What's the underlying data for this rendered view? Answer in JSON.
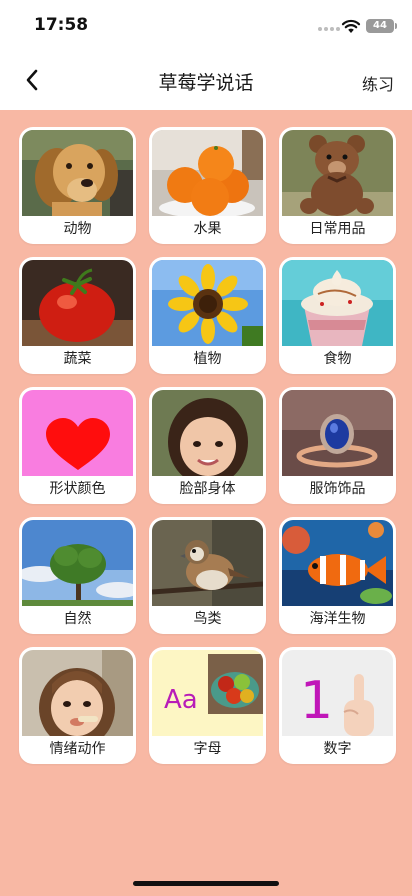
{
  "status_bar": {
    "time": "17:58",
    "battery": "44"
  },
  "nav": {
    "title": "草莓学说话",
    "right_action": "练习",
    "back_icon": "chevron-left-icon"
  },
  "colors": {
    "background": "#f8b8a4",
    "card": "#ffffff"
  },
  "categories": [
    {
      "label": "动物",
      "image": "dog-photo"
    },
    {
      "label": "水果",
      "image": "oranges-photo"
    },
    {
      "label": "日常用品",
      "image": "teddy-bear-photo"
    },
    {
      "label": "蔬菜",
      "image": "tomato-photo"
    },
    {
      "label": "植物",
      "image": "sunflower-photo"
    },
    {
      "label": "食物",
      "image": "ice-cream-photo"
    },
    {
      "label": "形状颜色",
      "image": "heart-shape"
    },
    {
      "label": "脸部身体",
      "image": "girl-face-photo"
    },
    {
      "label": "服饰饰品",
      "image": "ring-photo"
    },
    {
      "label": "自然",
      "image": "tree-photo"
    },
    {
      "label": "鸟类",
      "image": "sparrow-photo"
    },
    {
      "label": "海洋生物",
      "image": "clownfish-photo"
    },
    {
      "label": "情绪动作",
      "image": "child-eating-photo"
    },
    {
      "label": "字母",
      "image": "letters-apples",
      "image_text": "Aa"
    },
    {
      "label": "数字",
      "image": "number-hand",
      "image_text": "1"
    }
  ]
}
